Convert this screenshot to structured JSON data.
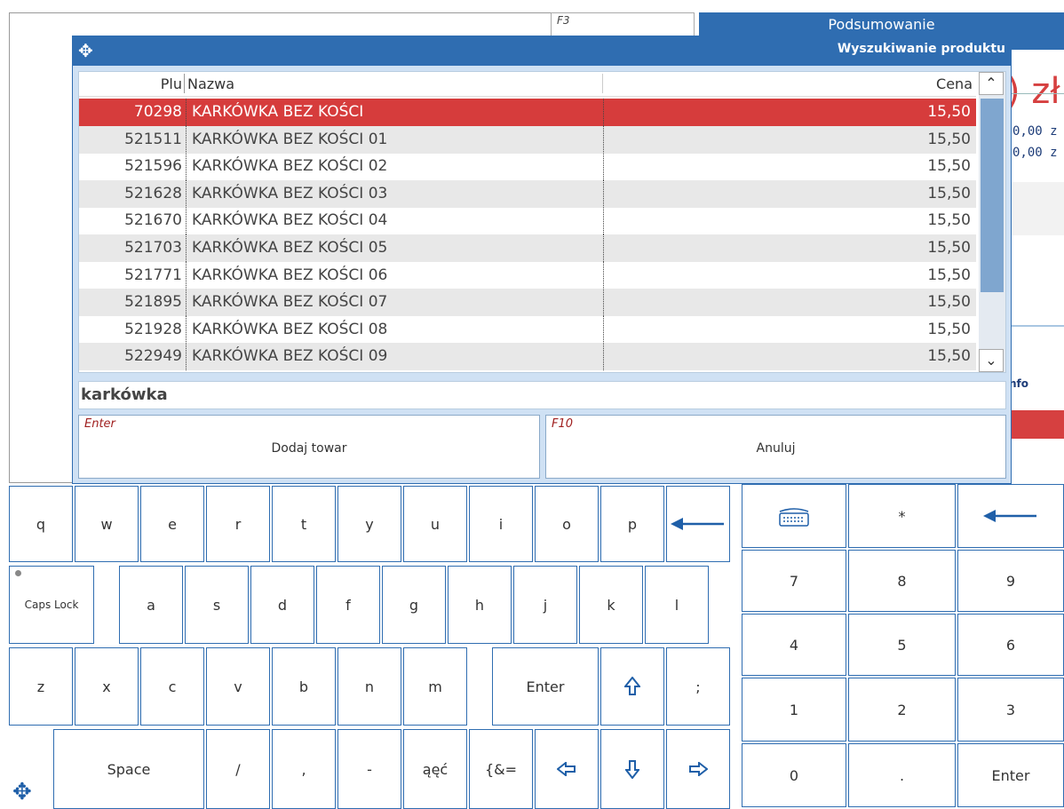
{
  "background": {
    "f3_hint": "F3",
    "summary_title": "Podsumowanie",
    "total_partial": ") zł",
    "amount1": "0,00 z",
    "amount2": "0,00 z",
    "info_partial": "nfo"
  },
  "dialog": {
    "title": "Wyszukiwanie produktu",
    "columns": {
      "plu": "Plu",
      "name": "Nazwa",
      "price": "Cena"
    },
    "rows": [
      {
        "plu": "70298",
        "name": "KARKÓWKA BEZ KOŚCI",
        "price": "15,50"
      },
      {
        "plu": "521511",
        "name": "KARKÓWKA BEZ KOŚCI 01",
        "price": "15,50"
      },
      {
        "plu": "521596",
        "name": "KARKÓWKA BEZ KOŚCI 02",
        "price": "15,50"
      },
      {
        "plu": "521628",
        "name": "KARKÓWKA BEZ KOŚCI 03",
        "price": "15,50"
      },
      {
        "plu": "521670",
        "name": "KARKÓWKA BEZ KOŚCI 04",
        "price": "15,50"
      },
      {
        "plu": "521703",
        "name": "KARKÓWKA BEZ KOŚCI 05",
        "price": "15,50"
      },
      {
        "plu": "521771",
        "name": "KARKÓWKA BEZ KOŚCI 06",
        "price": "15,50"
      },
      {
        "plu": "521895",
        "name": "KARKÓWKA BEZ KOŚCI 07",
        "price": "15,50"
      },
      {
        "plu": "521928",
        "name": "KARKÓWKA BEZ KOŚCI 08",
        "price": "15,50"
      },
      {
        "plu": "522949",
        "name": "KARKÓWKA BEZ KOŚCI 09",
        "price": "15,50"
      }
    ],
    "search_value": "karkówka",
    "add_button": {
      "hotkey": "Enter",
      "label": "Dodaj towar"
    },
    "cancel_button": {
      "hotkey": "F10",
      "label": "Anuluj"
    }
  },
  "keyboard": {
    "row1": [
      "q",
      "w",
      "e",
      "r",
      "t",
      "y",
      "u",
      "i",
      "o",
      "p"
    ],
    "row2": [
      "a",
      "s",
      "d",
      "f",
      "g",
      "h",
      "j",
      "k",
      "l"
    ],
    "row3": [
      "z",
      "x",
      "c",
      "v",
      "b",
      "n",
      "m"
    ],
    "caps": "Caps Lock",
    "enter": "Enter",
    "semicolon": ";",
    "space": "Space",
    "slash": "/",
    "comma": ",",
    "dash": "-",
    "diacritics": "ąęć",
    "symbols": "{&=",
    "numpad_star": "*",
    "numpad": [
      "7",
      "8",
      "9",
      "4",
      "5",
      "6",
      "1",
      "2",
      "3",
      "0",
      ".",
      "Enter"
    ]
  }
}
